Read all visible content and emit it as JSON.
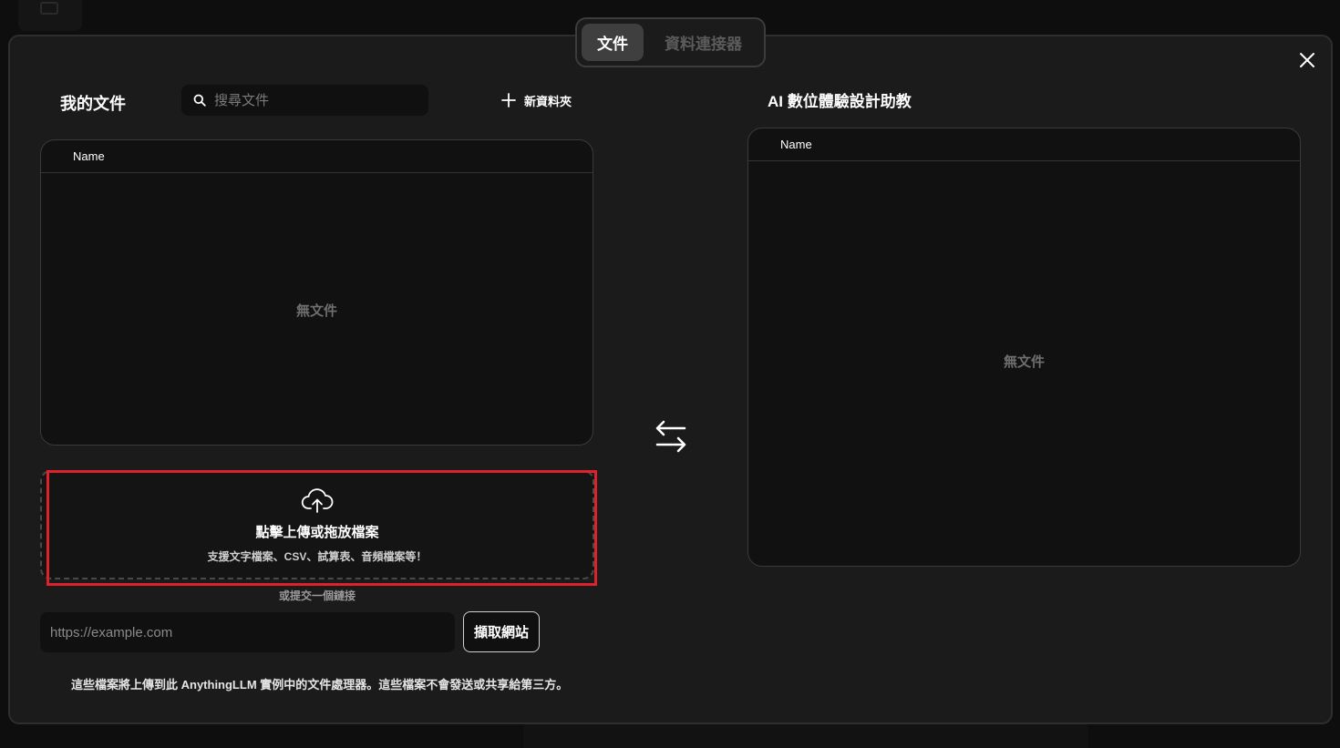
{
  "tabs": [
    {
      "label": "文件",
      "active": true
    },
    {
      "label": "資料連接器",
      "active": false
    }
  ],
  "my_documents": {
    "title": "我的文件",
    "search_placeholder": "搜尋文件",
    "new_folder_label": "新資料夾",
    "column_header": "Name",
    "empty_text": "無文件"
  },
  "upload": {
    "title": "點擊上傳或拖放檔案",
    "subtitle": "支援文字檔案、CSV、試算表、音頻檔案等！",
    "highlight_color": "#e0202a"
  },
  "link": {
    "or_label": "或提交一個鏈接",
    "url_placeholder": "https://example.com",
    "fetch_label": "擷取網站"
  },
  "disclaimer": "這些檔案將上傳到此 AnythingLLM 實例中的文件處理器。這些檔案不會發送或共享給第三方。",
  "workspace": {
    "title": "AI 數位體驗設計助教",
    "column_header": "Name",
    "empty_text": "無文件"
  },
  "icons": {
    "close": "close-icon",
    "search": "search-icon",
    "plus": "plus-icon",
    "upload": "cloud-upload-icon",
    "swap": "swap-arrows-icon"
  },
  "colors": {
    "modal_bg": "#1b1b1b",
    "panel_bg": "#111111",
    "highlight": "#e0202a"
  }
}
